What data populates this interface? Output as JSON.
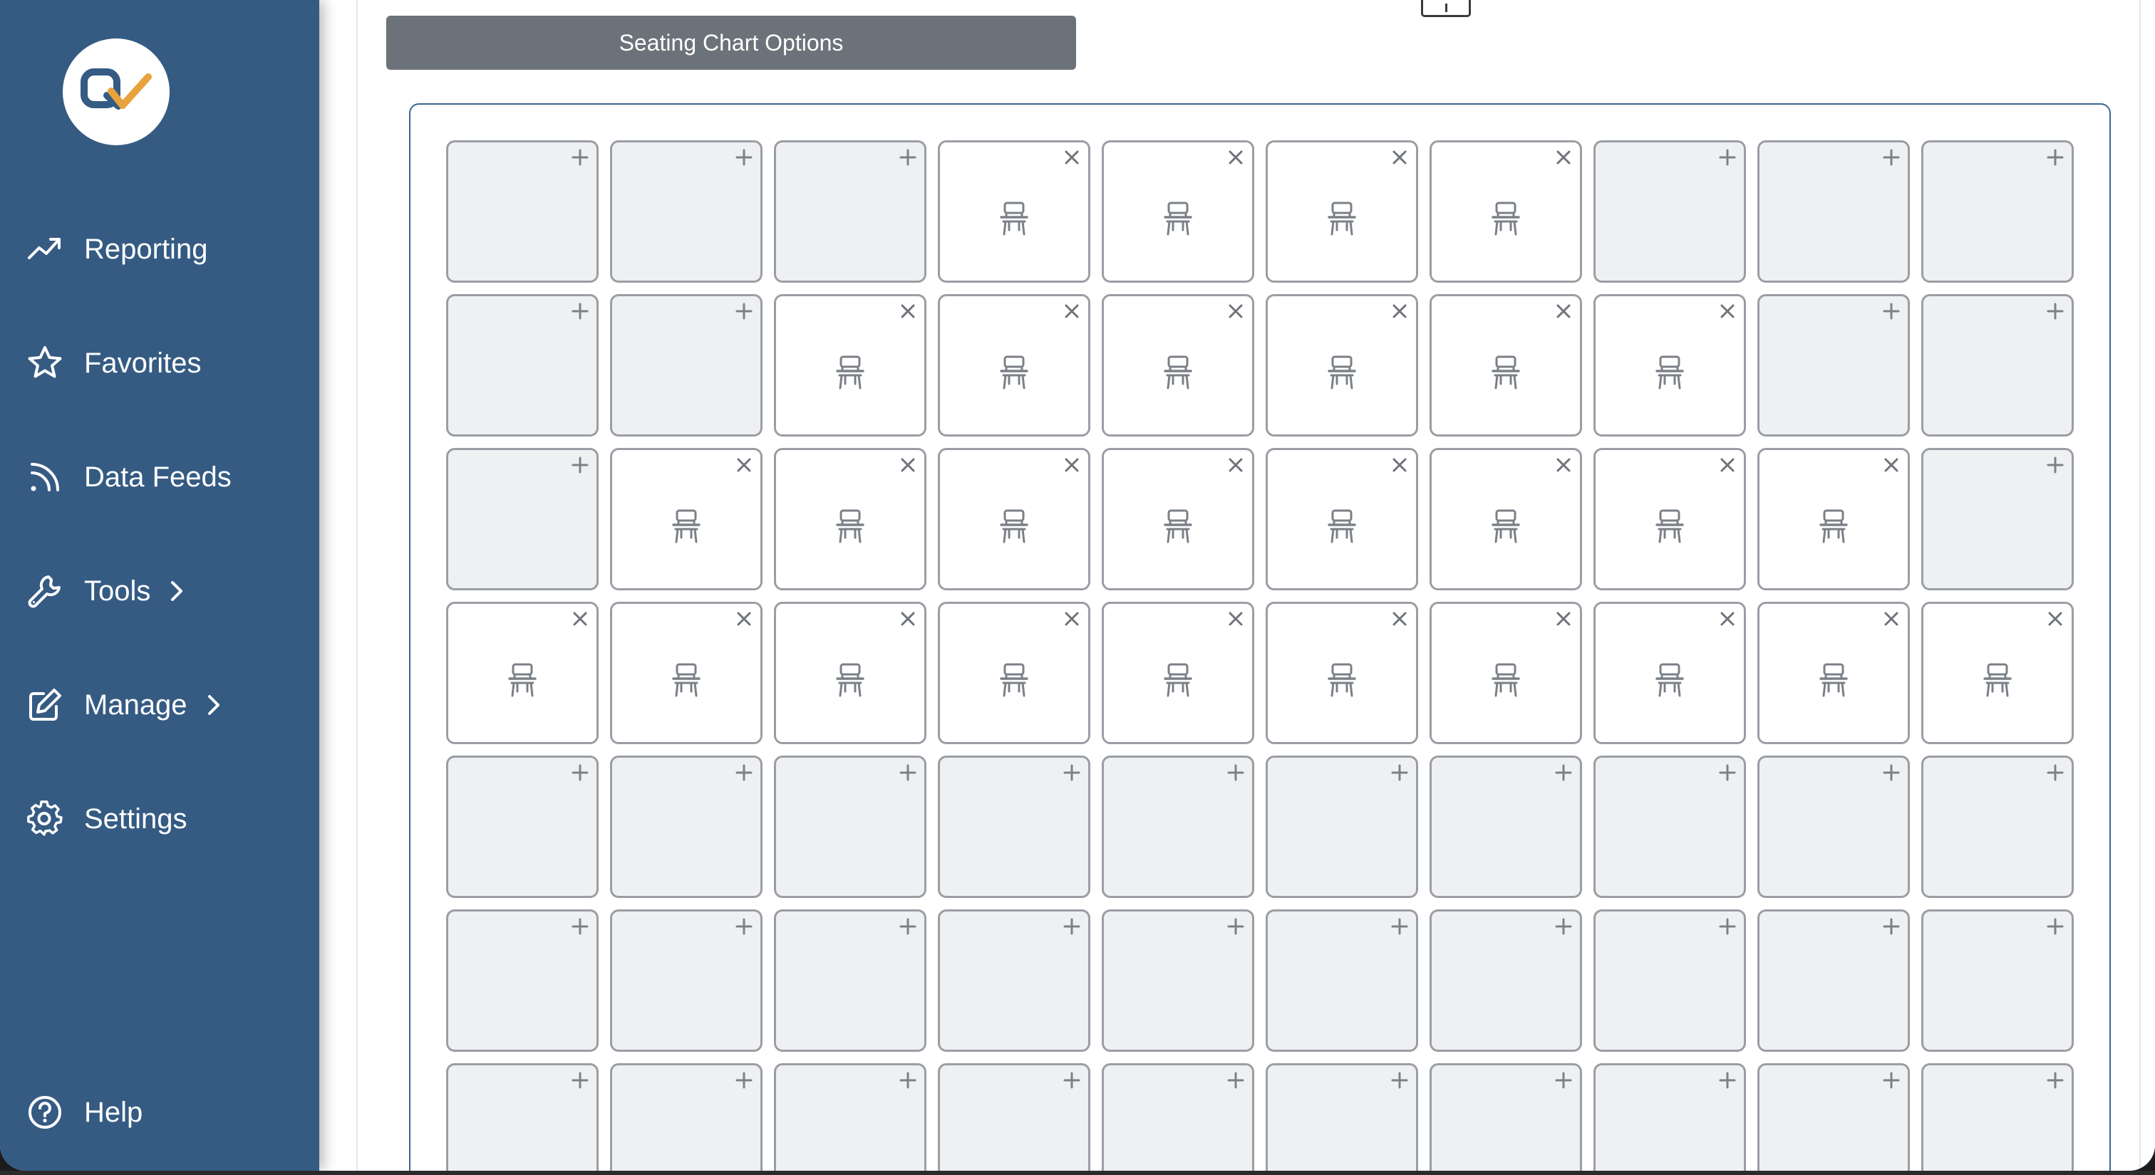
{
  "sidebar": {
    "logo": {
      "icon": "logo-check-icon",
      "accent_color": "#e8a33d",
      "brand_color": "#355b83"
    },
    "items": [
      {
        "key": "reporting",
        "label": "Reporting",
        "icon": "trend-up-icon",
        "has_submenu": false
      },
      {
        "key": "favorites",
        "label": "Favorites",
        "icon": "star-icon",
        "has_submenu": false
      },
      {
        "key": "data-feeds",
        "label": "Data Feeds",
        "icon": "rss-icon",
        "has_submenu": false
      },
      {
        "key": "tools",
        "label": "Tools",
        "icon": "wrench-icon",
        "has_submenu": true
      },
      {
        "key": "manage",
        "label": "Manage",
        "icon": "edit-icon",
        "has_submenu": true
      },
      {
        "key": "settings",
        "label": "Settings",
        "icon": "gear-icon",
        "has_submenu": false
      }
    ],
    "help": {
      "label": "Help",
      "icon": "help-circle-icon"
    }
  },
  "main": {
    "options_button": {
      "label": "Seating Chart Options"
    },
    "seating_chart": {
      "columns": 10,
      "rows": [
        [
          0,
          0,
          0,
          1,
          1,
          1,
          1,
          0,
          0,
          0
        ],
        [
          0,
          0,
          1,
          1,
          1,
          1,
          1,
          1,
          0,
          0
        ],
        [
          0,
          1,
          1,
          1,
          1,
          1,
          1,
          1,
          1,
          0
        ],
        [
          1,
          1,
          1,
          1,
          1,
          1,
          1,
          1,
          1,
          1
        ],
        [
          0,
          0,
          0,
          0,
          0,
          0,
          0,
          0,
          0,
          0
        ],
        [
          0,
          0,
          0,
          0,
          0,
          0,
          0,
          0,
          0,
          0
        ],
        [
          0,
          0,
          0,
          0,
          0,
          0,
          0,
          0,
          0,
          0
        ]
      ],
      "legend": {
        "1": "desk placed (remove with ×)",
        "0": "empty slot (add with +)"
      },
      "colors": {
        "panel_border": "#3c6690",
        "empty_fill": "#eff0f2",
        "desk_fill": "#ffffff",
        "cell_border": "#9a9ea4"
      }
    }
  }
}
